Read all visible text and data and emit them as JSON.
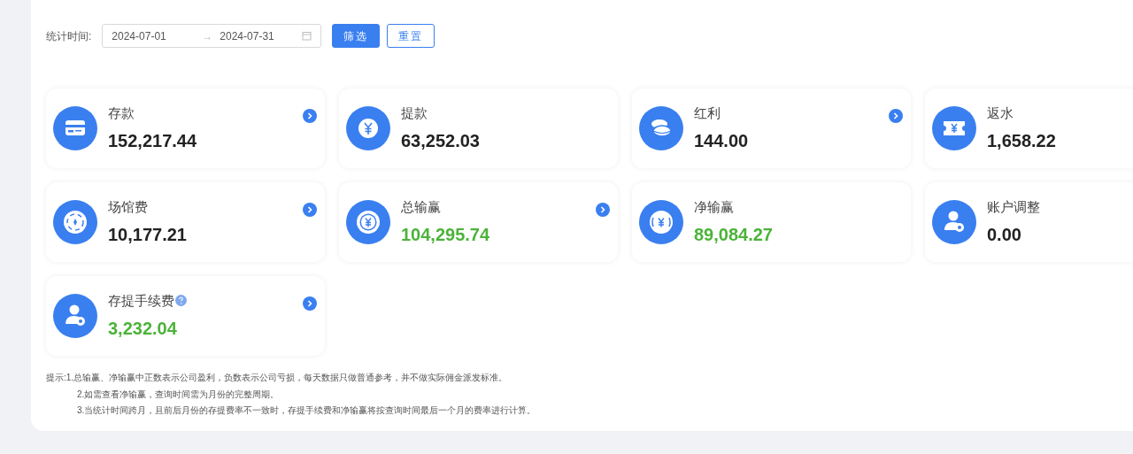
{
  "filter": {
    "label": "统计时间:",
    "start_date": "2024-07-01",
    "separator": "→",
    "end_date": "2024-07-31",
    "buttons": [
      {
        "label": "筛选",
        "kind": "primary"
      },
      {
        "label": "重置",
        "kind": "outline"
      }
    ]
  },
  "stats": [
    {
      "title": "存款",
      "value": "152,217.44",
      "kind": "card",
      "positive": false,
      "link": true,
      "help": false
    },
    {
      "title": "提款",
      "value": "63,252.03",
      "kind": "yen",
      "positive": false,
      "link": false,
      "help": false
    },
    {
      "title": "红利",
      "value": "144.00",
      "kind": "coins",
      "positive": false,
      "link": true,
      "help": false
    },
    {
      "title": "返水",
      "value": "1,658.22",
      "kind": "ticket",
      "positive": false,
      "link": false,
      "help": false
    },
    {
      "title": "场馆费",
      "value": "10,177.21",
      "kind": "chip",
      "positive": false,
      "link": true,
      "help": false
    },
    {
      "title": "总输赢",
      "value": "104,295.74",
      "kind": "ring",
      "positive": true,
      "link": true,
      "help": false
    },
    {
      "title": "净输赢",
      "value": "89,084.27",
      "kind": "bracket",
      "positive": true,
      "link": false,
      "help": false
    },
    {
      "title": "账户调整",
      "value": "0.00",
      "kind": "user",
      "positive": false,
      "link": false,
      "help": false
    },
    {
      "title": "存提手续费",
      "value": "3,232.04",
      "kind": "user",
      "positive": true,
      "link": true,
      "help": true
    }
  ],
  "notes": {
    "label": "提示:",
    "lines": [
      "1.总输赢、净输赢中正数表示公司盈利，负数表示公司亏损，每天数据只做普通参考，并不做实际佣金派发标准。",
      "2.如需查看净输赢，查询时间需为月份的完整周期。",
      "3.当统计时间跨月，且前后月份的存提费率不一致时，存提手续费和净输赢将按查询时间最后一个月的费率进行计算。"
    ]
  }
}
